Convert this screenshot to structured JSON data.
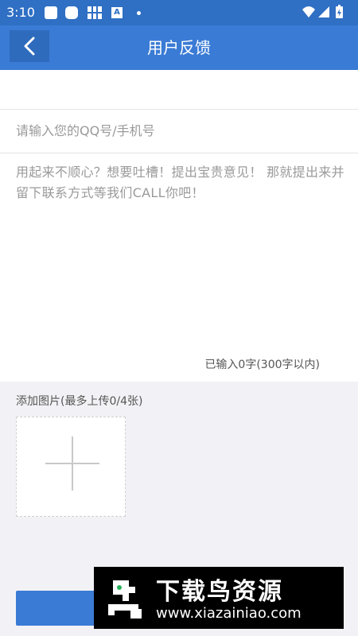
{
  "status_bar": {
    "time": "3:10"
  },
  "app_bar": {
    "title": "用户反馈"
  },
  "form": {
    "contact_placeholder": "请输入您的QQ号/手机号",
    "feedback_placeholder": "用起来不顺心？想要吐槽！提出宝贵意见！ 那就提出来并留下联系方式等我们CALL你吧！",
    "counter": "已输入0字(300字以内)",
    "image_label": "添加图片(最多上传0/4张)"
  },
  "watermark": {
    "title": "下载鸟资源",
    "url": "www.xiazainiao.com"
  },
  "colors": {
    "primary": "#3a7bd5",
    "status_bar": "#2f6fc4",
    "background": "#f2f2f6"
  }
}
